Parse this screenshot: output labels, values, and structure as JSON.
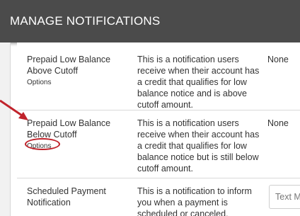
{
  "header": {
    "title": "MANAGE NOTIFICATIONS"
  },
  "rows": [
    {
      "name": "Prepaid Low Balance Above Cutoff",
      "options": "Options",
      "description": "This is a notification users receive when their account has a credit that qualifies for low balance notice and is above cutoff amount.",
      "channel": "None"
    },
    {
      "name": "Prepaid Low Balance Below Cutoff",
      "options": "Options",
      "description": "This is a notification users receive when their account has a credit that qualifies for low balance notice but is still below cutoff amount.",
      "channel": "None"
    },
    {
      "name": "Scheduled Payment Notification",
      "description": "This is a notification to inform you when a payment is scheduled or canceled.",
      "channel_select": "Text Me"
    }
  ],
  "colors": {
    "header_bg": "#4b4b4b",
    "highlight": "#c0232b"
  }
}
